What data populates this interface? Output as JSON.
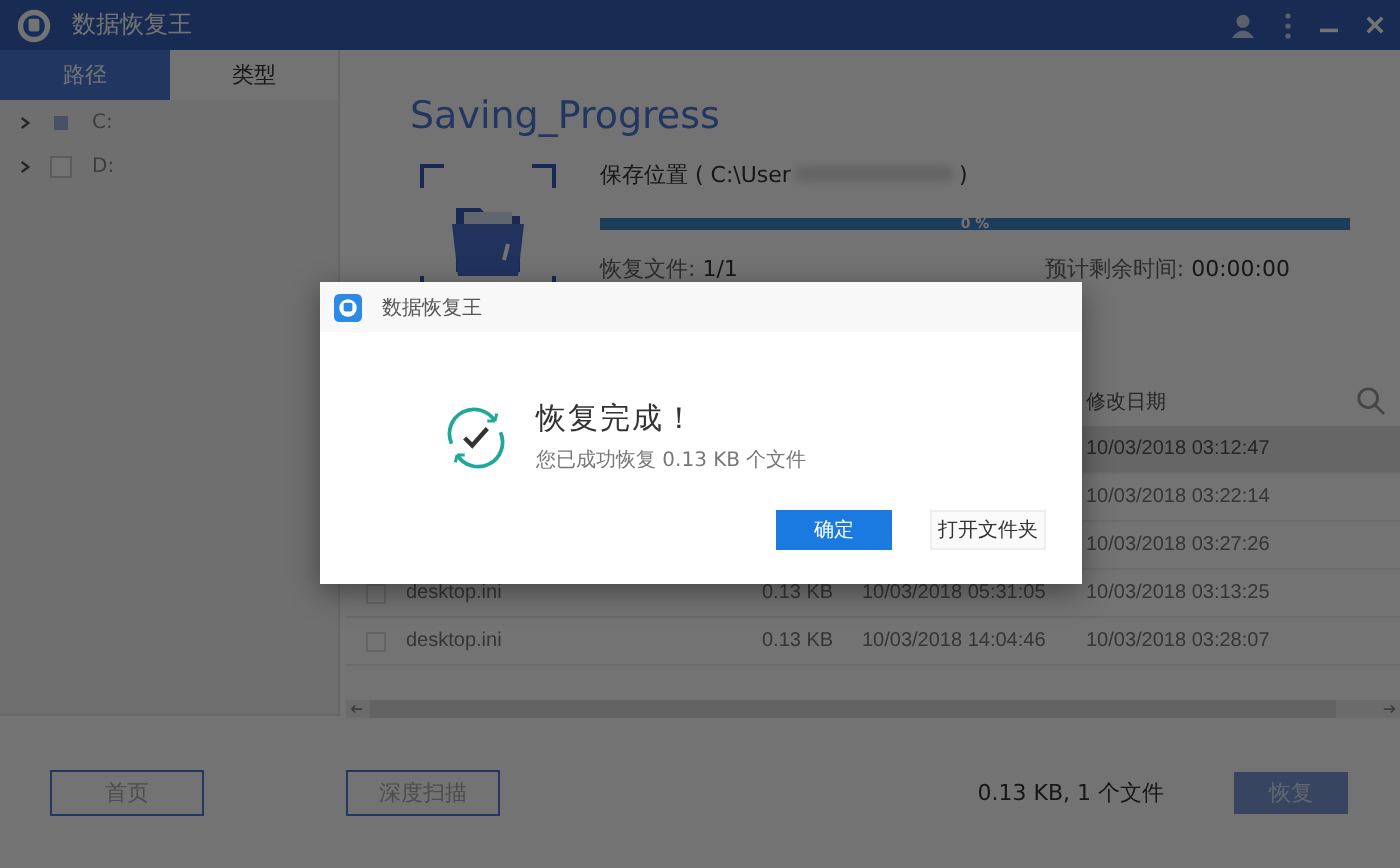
{
  "window": {
    "title": "数据恢复王"
  },
  "tabs": [
    {
      "label": "路径",
      "selected": true
    },
    {
      "label": "类型",
      "selected": false
    }
  ],
  "tree": [
    {
      "label": "C:",
      "checked": true
    },
    {
      "label": "D:",
      "checked": false
    }
  ],
  "progress": {
    "title": "Saving_Progress",
    "save_location": "保存位置 ( C:\\User",
    "save_location_end": ")",
    "level": 1,
    "percent": "0 %",
    "files_label": "恢复文件:",
    "files_value": "1/1",
    "remaining_label": "预计剩余时间:",
    "remaining_value": "00:00:00"
  },
  "table": {
    "columns": [
      {
        "label": "修改日期"
      }
    ],
    "rows": [
      {
        "modified": "10/03/2018 03:12:47",
        "selected": true
      },
      {
        "modified": "10/03/2018 03:22:14",
        "selected": false
      },
      {
        "modified": "10/03/2018 03:27:26",
        "selected": false
      },
      {
        "name": "desktop.ini",
        "size": "0.13 KB",
        "created": "10/03/2018 05:31:05",
        "modified": "10/03/2018 03:13:25",
        "selected": false
      },
      {
        "name": "desktop.ini",
        "size": "0.13 KB",
        "created": "10/03/2018 14:04:46",
        "modified": "10/03/2018 03:28:07",
        "selected": false
      }
    ]
  },
  "footer": {
    "home": "首页",
    "deep_scan": "深度扫描",
    "summary": "0.13 KB, 1 个文件",
    "recover": "恢复"
  },
  "dialog": {
    "title": "数据恢复王",
    "heading": "恢复完成！",
    "message": "您已成功恢复 0.13 KB 个文件",
    "buttons": [
      {
        "label": "确定",
        "kind": "primary"
      },
      {
        "label": "打开文件夹",
        "kind": "secondary"
      }
    ]
  }
}
